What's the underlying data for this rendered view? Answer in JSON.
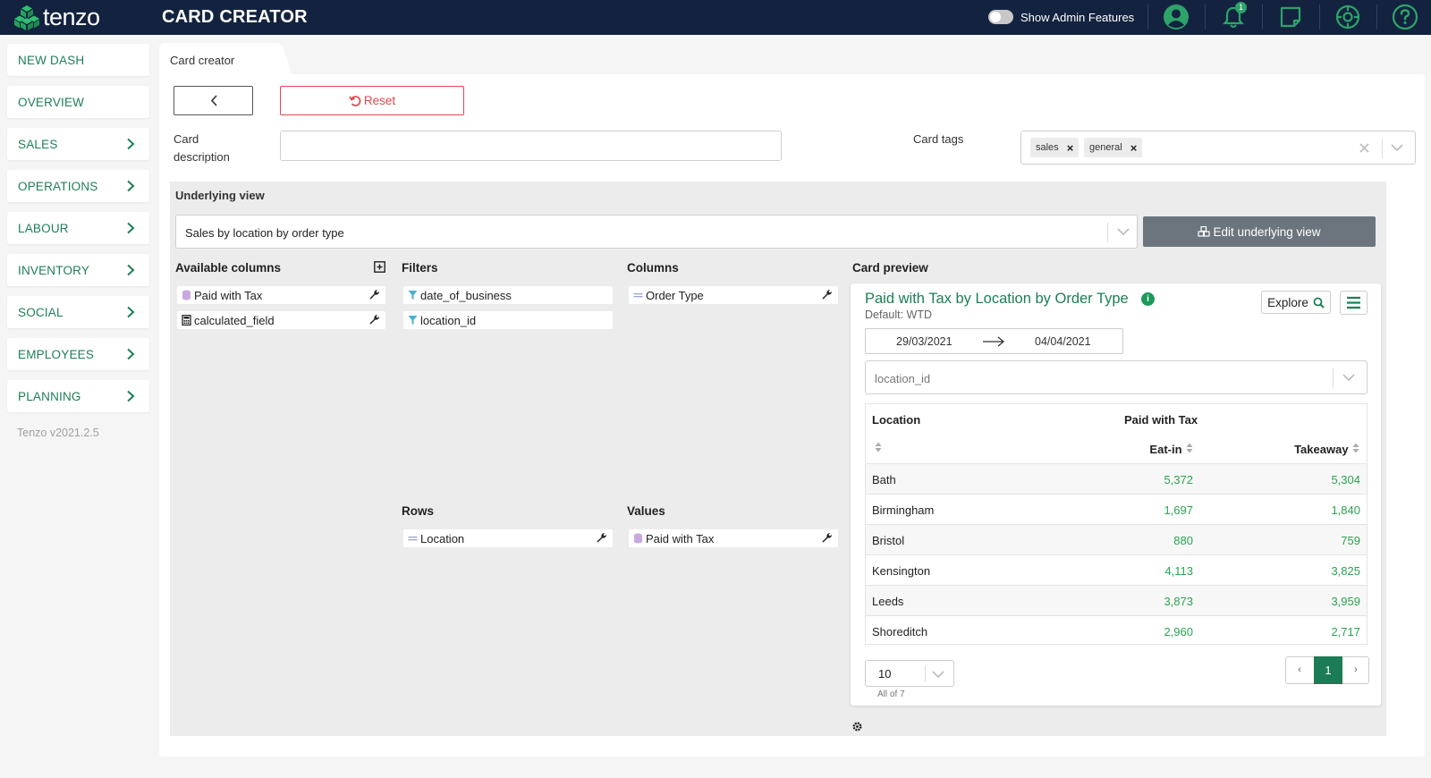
{
  "app": {
    "brand": "tenzo",
    "page_heading": "CARD CREATOR"
  },
  "topbar": {
    "admin_toggle_label": "Show Admin Features",
    "notification_count": "1",
    "icons": [
      "user-icon",
      "bell-icon",
      "note-icon",
      "settings-icon",
      "help-icon"
    ]
  },
  "sidebar": {
    "items": [
      {
        "label": "NEW DASH",
        "has_chevron": false
      },
      {
        "label": "OVERVIEW",
        "has_chevron": false
      },
      {
        "label": "SALES",
        "has_chevron": true
      },
      {
        "label": "OPERATIONS",
        "has_chevron": true
      },
      {
        "label": "LABOUR",
        "has_chevron": true
      },
      {
        "label": "INVENTORY",
        "has_chevron": true
      },
      {
        "label": "SOCIAL",
        "has_chevron": true
      },
      {
        "label": "EMPLOYEES",
        "has_chevron": true
      },
      {
        "label": "PLANNING",
        "has_chevron": true
      }
    ],
    "version": "Tenzo v2021.2.5"
  },
  "tab": {
    "label": "Card creator"
  },
  "form": {
    "reset_label": "Reset",
    "card_description_label_line1": "Card",
    "card_description_label_line2": "description",
    "card_description_value": "",
    "card_tags_label": "Card tags",
    "tags": [
      "sales",
      "general"
    ]
  },
  "underlying_view": {
    "title": "Underlying view",
    "selected": "Sales by location by order type",
    "edit_button_label": "Edit underlying view"
  },
  "panels": {
    "available_columns": {
      "title": "Available columns",
      "fields": [
        "Paid with Tax",
        "calculated_field"
      ]
    },
    "filters": {
      "title": "Filters",
      "fields": [
        "date_of_business",
        "location_id"
      ]
    },
    "columns": {
      "title": "Columns",
      "fields": [
        "Order Type"
      ]
    },
    "rows": {
      "title": "Rows",
      "fields": [
        "Location"
      ]
    },
    "values": {
      "title": "Values",
      "fields": [
        "Paid with Tax"
      ]
    },
    "card_preview": {
      "title": "Card preview"
    }
  },
  "preview": {
    "title": "Paid with Tax by Location by Order Type",
    "subtitle": "Default: WTD",
    "explore_label": "Explore",
    "date_from": "29/03/2021",
    "date_to": "04/04/2021",
    "filter_placeholder": "location_id",
    "table": {
      "header_location": "Location",
      "header_group": "Paid with Tax",
      "sub_headers": [
        "Eat-in",
        "Takeaway"
      ],
      "rows": [
        {
          "location": "Bath",
          "eat_in": "5,372",
          "takeaway": "5,304"
        },
        {
          "location": "Birmingham",
          "eat_in": "1,697",
          "takeaway": "1,840"
        },
        {
          "location": "Bristol",
          "eat_in": "880",
          "takeaway": "759"
        },
        {
          "location": "Kensington",
          "eat_in": "4,113",
          "takeaway": "3,825"
        },
        {
          "location": "Leeds",
          "eat_in": "3,873",
          "takeaway": "3,959"
        },
        {
          "location": "Shoreditch",
          "eat_in": "2,960",
          "takeaway": "2,717"
        }
      ]
    },
    "page_size": "10",
    "record_count": "All of 7",
    "current_page": "1",
    "prev_label": "‹",
    "next_label": "›"
  },
  "colors": {
    "topbar": "#13233f",
    "accent_green": "#1d7f55",
    "value_green": "#2aa44f",
    "reset_red": "#e0474d",
    "edit_button_gray": "#6c757d"
  }
}
